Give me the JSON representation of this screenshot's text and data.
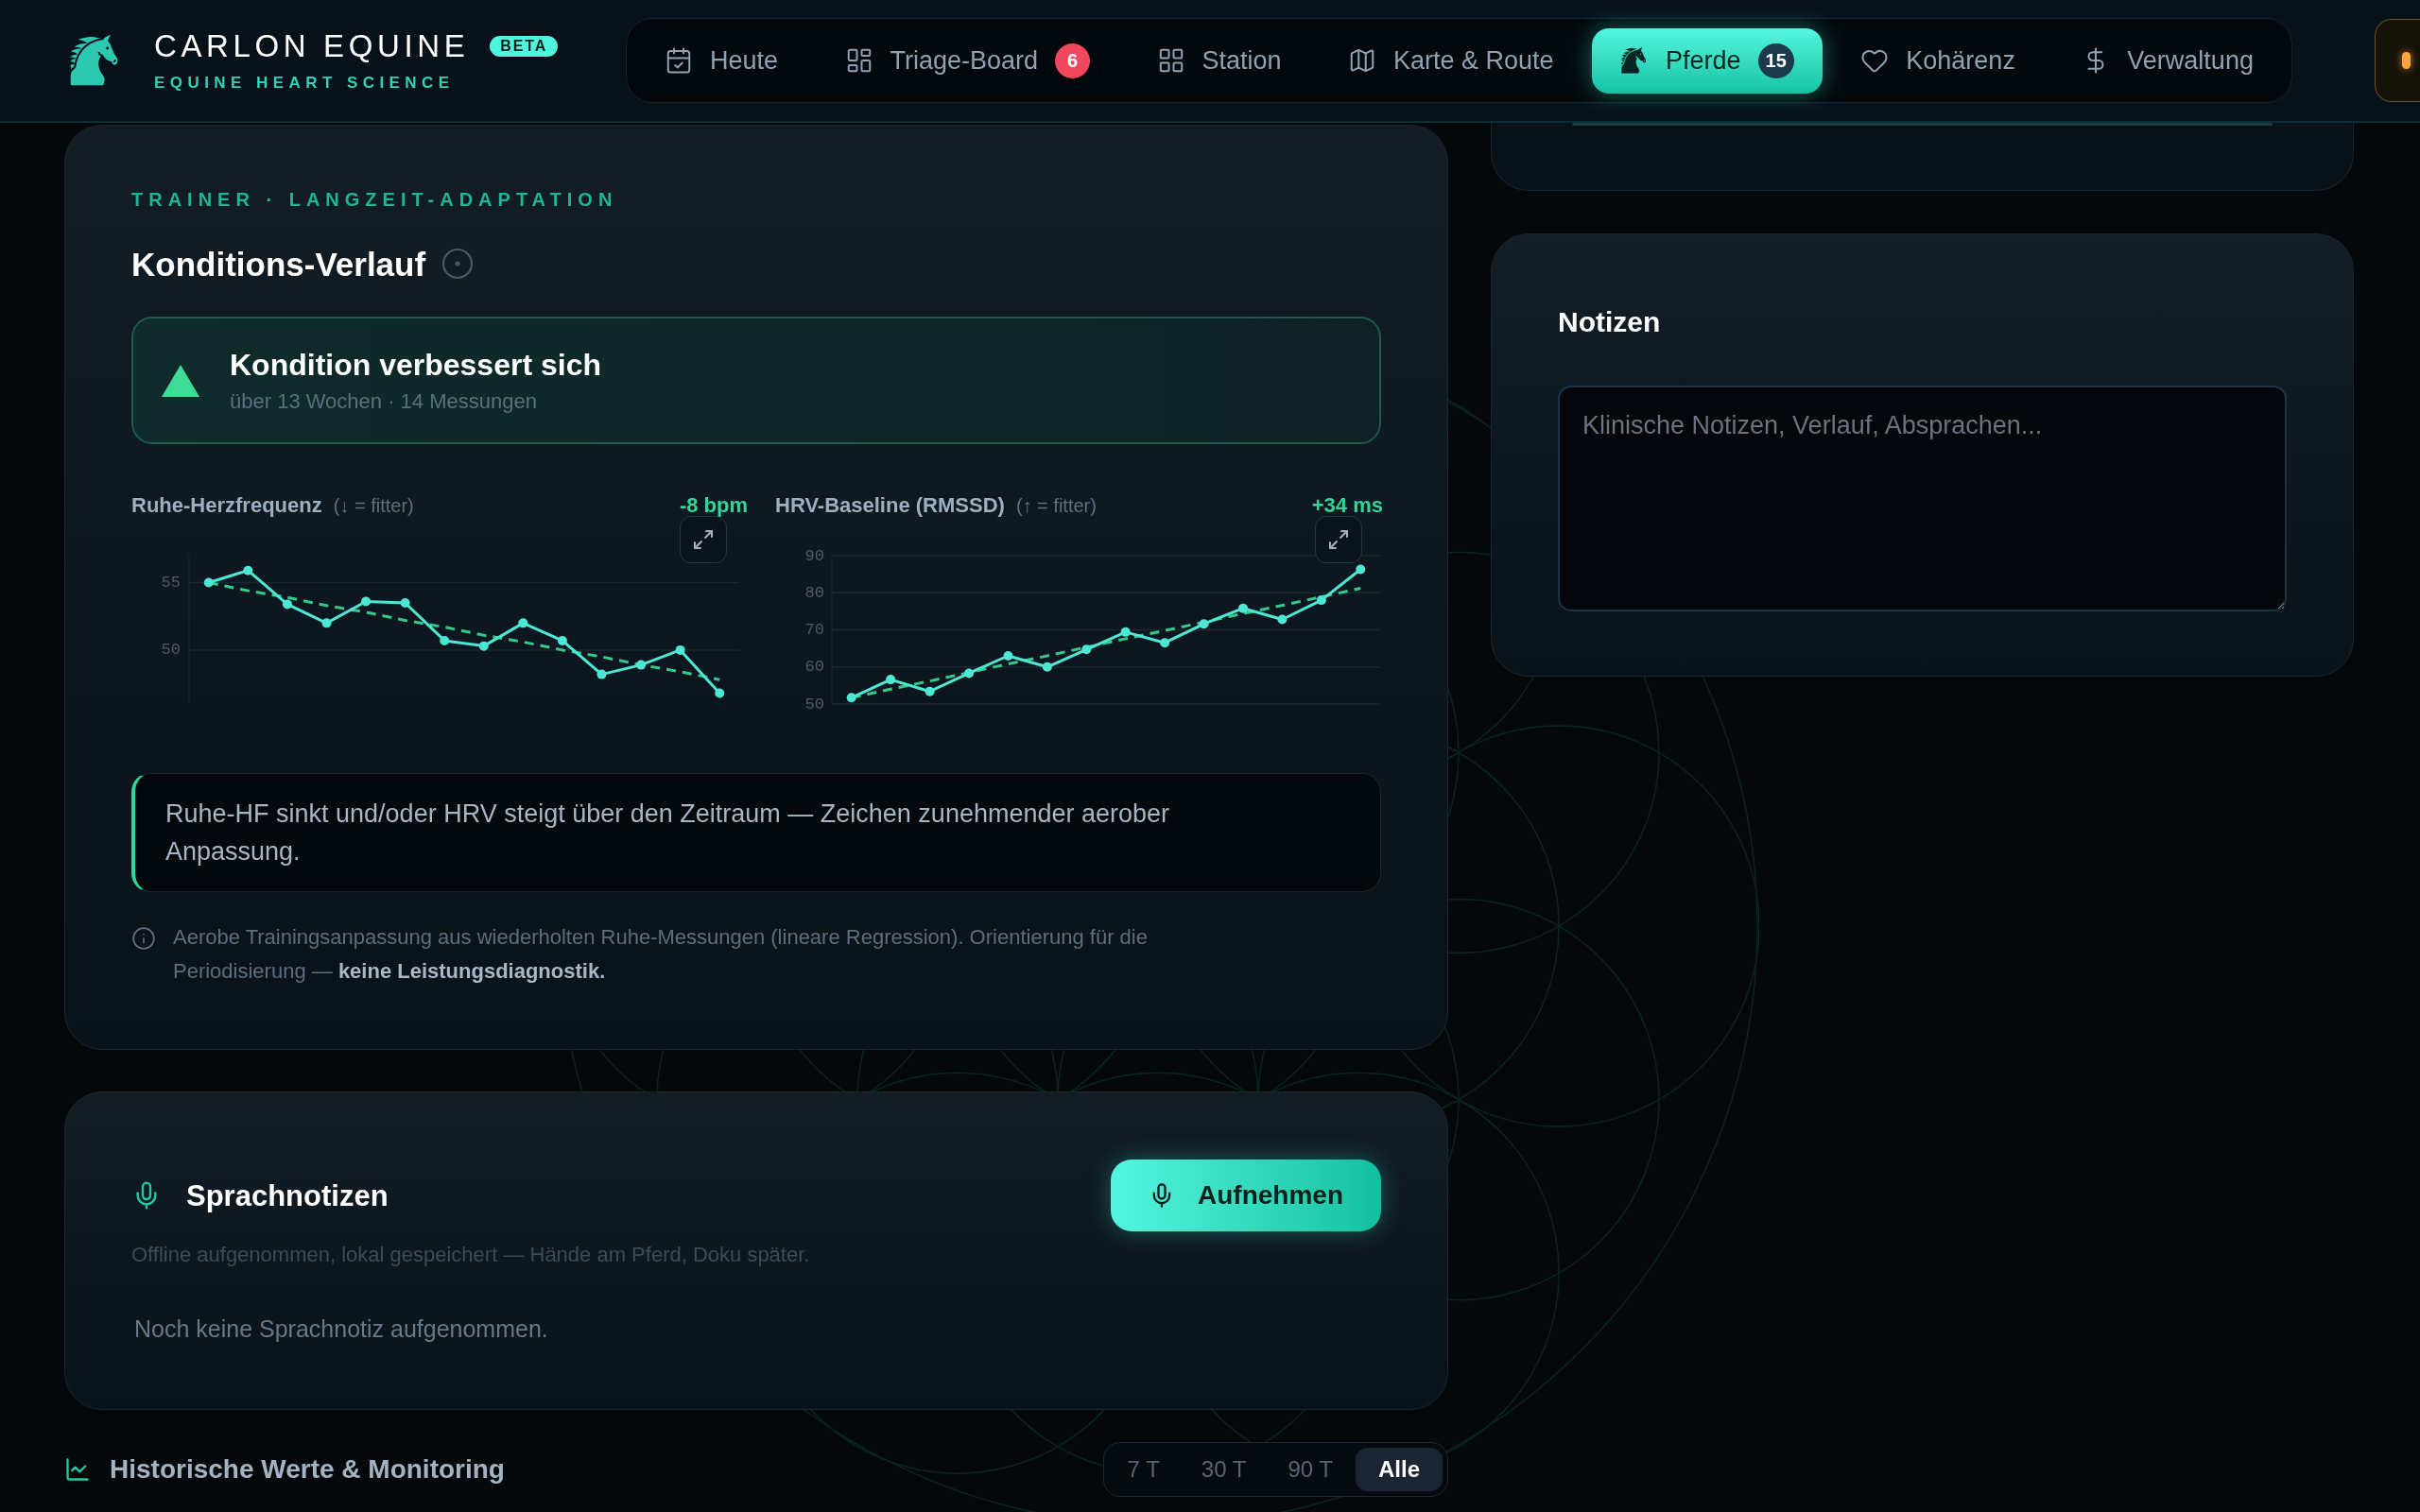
{
  "header": {
    "brand": {
      "name": "CARLON EQUINE",
      "badge": "BETA",
      "tagline": "EQUINE HEART SCIENCE"
    },
    "nav": [
      {
        "label": "Heute",
        "selected": false
      },
      {
        "label": "Triage-Board",
        "selected": false,
        "badge": {
          "text": "6",
          "color": "#f2475c"
        }
      },
      {
        "label": "Station",
        "selected": false
      },
      {
        "label": "Karte & Route",
        "selected": false
      },
      {
        "label": "Pferde",
        "selected": true,
        "badge": {
          "text": "15",
          "color": "#1d3a4b"
        }
      },
      {
        "label": "Kohärenz",
        "selected": false
      },
      {
        "label": "Verwaltung",
        "selected": false
      }
    ]
  },
  "condition_card": {
    "eyebrow": "TRAINER · LANGZEIT-ADAPTATION",
    "title": "Konditions-Verlauf",
    "status": {
      "improving": true,
      "title": "Kondition verbessert sich",
      "subtitle": "über 13 Wochen · 14 Messungen"
    },
    "charts": [
      {
        "hint": "(↓ = fitter)",
        "delta": "-8 bpm",
        "chart_data": {
          "type": "line",
          "title": "Ruhe-Herzfrequenz",
          "ylim": [
            46,
            57
          ],
          "yticks": [
            50,
            55
          ],
          "grid": true,
          "series": [
            {
              "color": "#4de8d5",
              "line_style": "solid",
              "marker": "circle",
              "values": [
                55.0,
                55.9,
                53.4,
                52.0,
                53.6,
                53.5,
                50.7,
                50.3,
                52.0,
                50.7,
                48.2,
                48.9,
                50.0,
                46.8
              ]
            },
            {
              "color": "#34c98a",
              "line_style": "dashed",
              "marker": "none",
              "values": [
                55.0,
                54.4,
                53.9,
                53.3,
                52.8,
                52.2,
                51.7,
                51.1,
                50.6,
                50.0,
                49.5,
                48.9,
                48.4,
                47.8
              ]
            }
          ]
        }
      },
      {
        "hint": "(↑ = fitter)",
        "delta": "+34 ms",
        "chart_data": {
          "type": "line",
          "title": "HRV-Baseline (RMSSD)",
          "ylim": [
            50,
            90
          ],
          "yticks": [
            50,
            60,
            70,
            80,
            90
          ],
          "grid": true,
          "series": [
            {
              "color": "#4de8d5",
              "line_style": "solid",
              "marker": "circle",
              "values": [
                51.7,
                56.6,
                53.4,
                58.3,
                63.0,
                60.0,
                64.7,
                69.4,
                66.5,
                71.6,
                75.8,
                72.8,
                78.0,
                86.3
              ]
            },
            {
              "color": "#34c98a",
              "line_style": "dashed",
              "marker": "none",
              "values": [
                51.7,
                54.0,
                56.2,
                58.5,
                60.8,
                63.0,
                65.3,
                67.6,
                69.8,
                72.1,
                74.4,
                76.6,
                78.9,
                81.2
              ]
            }
          ]
        }
      }
    ],
    "summary": "Ruhe-HF sinkt und/oder HRV steigt über den Zeitraum — Zeichen zunehmender aerober Anpassung.",
    "footnote": "Aerobe Trainingsanpassung aus wiederholten Ruhe-Messungen (lineare Regression). Orientierung für die Periodisierung — **keine Leistungsdiagnostik.**"
  },
  "voice_notes": {
    "title": "Sprachnotizen",
    "record_button": "Aufnehmen",
    "subtitle": "Offline aufgenommen, lokal gespeichert — Hände am Pferd, Doku später.",
    "empty_text": "Noch keine Sprachnotiz aufgenommen."
  },
  "history": {
    "title": "Historische Werte & Monitoring",
    "ranges": [
      {
        "label": "7 T",
        "selected": false
      },
      {
        "label": "30 T",
        "selected": false
      },
      {
        "label": "90 T",
        "selected": false
      },
      {
        "label": "Alle",
        "selected": true
      }
    ]
  },
  "notes": {
    "title": "Notizen",
    "placeholder": "Klinische Notizen, Verlauf, Absprachen..."
  }
}
